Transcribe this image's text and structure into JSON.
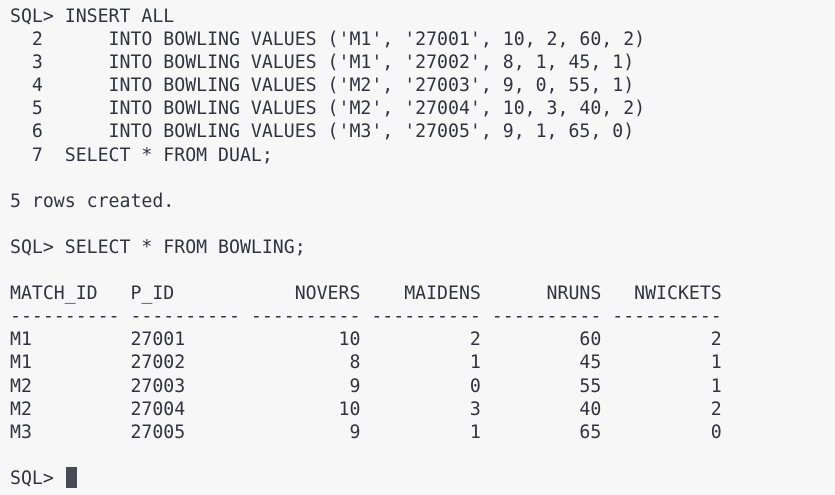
{
  "terminal": {
    "lines": [
      "SQL> INSERT ALL",
      "  2      INTO BOWLING VALUES ('M1', '27001', 10, 2, 60, 2)",
      "  3      INTO BOWLING VALUES ('M1', '27002', 8, 1, 45, 1)",
      "  4      INTO BOWLING VALUES ('M2', '27003', 9, 0, 55, 1)",
      "  5      INTO BOWLING VALUES ('M2', '27004', 10, 3, 40, 2)",
      "  6      INTO BOWLING VALUES ('M3', '27005', 9, 1, 65, 0)",
      "  7  SELECT * FROM DUAL;",
      "",
      "5 rows created.",
      "",
      "SQL> SELECT * FROM BOWLING;",
      "",
      "MATCH_ID   P_ID           NOVERS    MAIDENS      NRUNS   NWICKETS",
      "---------- ---------- ---------- ---------- ---------- ----------",
      "M1         27001              10          2         60          2",
      "M1         27002               8          1         45          1",
      "M2         27003               9          0         55          1",
      "M2         27004              10          3         40          2",
      "M3         27005               9          1         65          0",
      ""
    ],
    "prompt": "SQL> "
  }
}
